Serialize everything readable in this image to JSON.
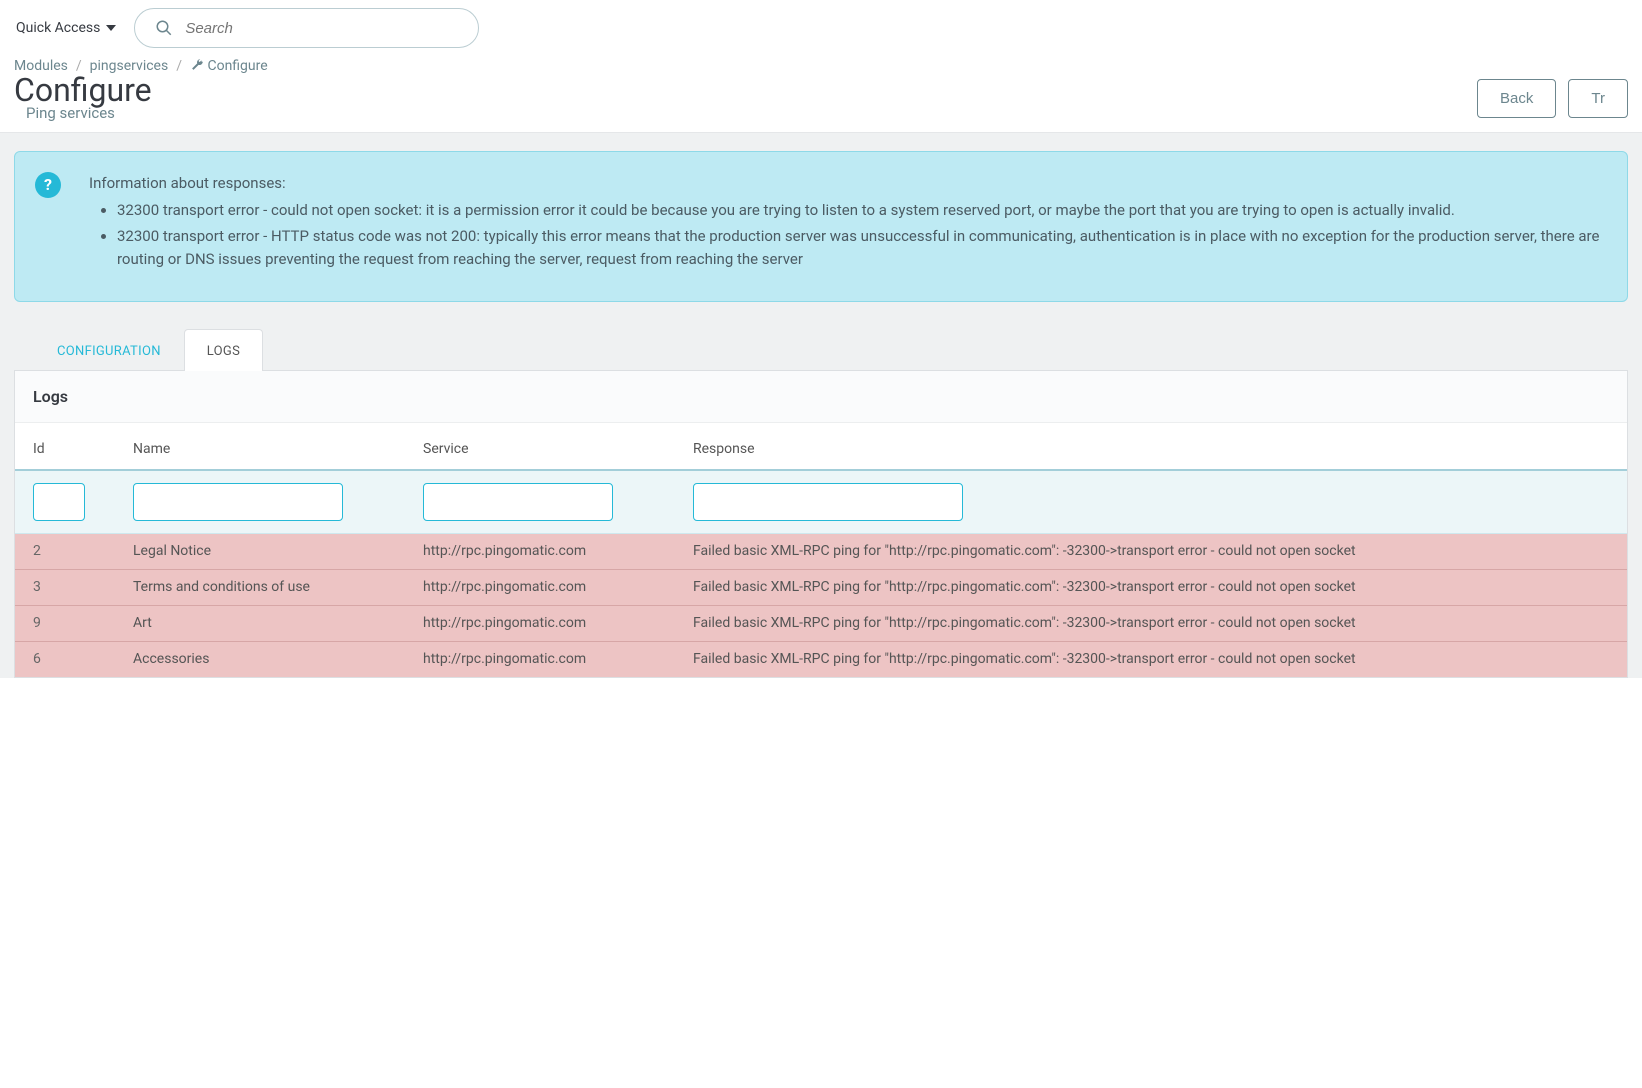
{
  "topbar": {
    "quick_access": "Quick Access",
    "search_placeholder": "Search"
  },
  "breadcrumbs": {
    "items": [
      "Modules",
      "pingservices",
      "Configure"
    ]
  },
  "header": {
    "title": "Configure",
    "subtitle": "Ping services",
    "back_label": "Back",
    "translate_label": "Tr"
  },
  "alert": {
    "intro": "Information about responses:",
    "items": [
      "32300 transport error - could not open socket: it is a permission error it could be because you are trying to listen to a system reserved port, or maybe the port that you are trying to open is actually invalid.",
      "32300 transport error - HTTP status code was not 200: typically this error means that the production server was unsuccessful in communicating, authentication is in place with no exception for the production server, there are routing or DNS issues preventing the request from reaching the server, request from reaching the server"
    ]
  },
  "tabs": {
    "configuration": "CONFIGURATION",
    "logs": "LOGS"
  },
  "panel": {
    "heading": "Logs"
  },
  "table": {
    "columns": {
      "id": "Id",
      "name": "Name",
      "service": "Service",
      "response": "Response"
    },
    "rows": [
      {
        "id": "2",
        "name": "Legal Notice",
        "service": "http://rpc.pingomatic.com",
        "response": "Failed basic XML-RPC ping for \"http://rpc.pingomatic.com\": -32300->transport error - could not open socket"
      },
      {
        "id": "3",
        "name": "Terms and conditions of use",
        "service": "http://rpc.pingomatic.com",
        "response": "Failed basic XML-RPC ping for \"http://rpc.pingomatic.com\": -32300->transport error - could not open socket"
      },
      {
        "id": "9",
        "name": "Art",
        "service": "http://rpc.pingomatic.com",
        "response": "Failed basic XML-RPC ping for \"http://rpc.pingomatic.com\": -32300->transport error - could not open socket"
      },
      {
        "id": "6",
        "name": "Accessories",
        "service": "http://rpc.pingomatic.com",
        "response": "Failed basic XML-RPC ping for \"http://rpc.pingomatic.com\": -32300->transport error - could not open socket"
      }
    ]
  }
}
